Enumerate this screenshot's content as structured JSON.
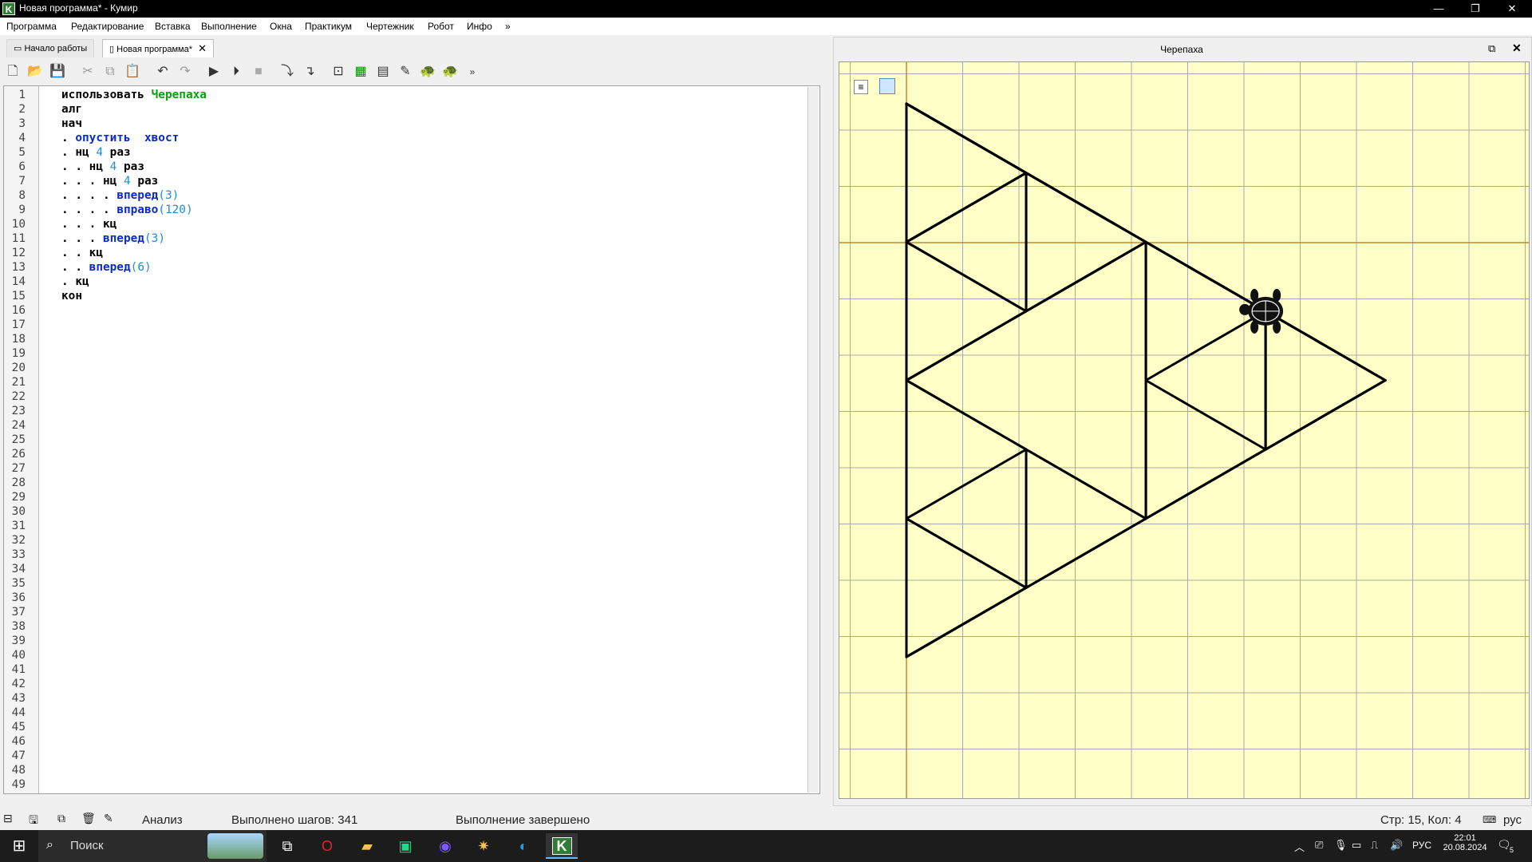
{
  "window": {
    "title": "Новая программа* - Кумир",
    "icon_letter": "K"
  },
  "menu": [
    "Программа",
    "Редактирование",
    "Вставка",
    "Выполнение",
    "Окна",
    "Практикум",
    "Чертежник",
    "Робот",
    "Инфо",
    "»"
  ],
  "tabs": [
    {
      "label": "Начало работы"
    },
    {
      "label": "Новая программа*"
    }
  ],
  "editor": {
    "line_count": 49,
    "lines": [
      [
        {
          "t": "использовать ",
          "c": "kw"
        },
        {
          "t": "Черепаха",
          "c": "green"
        }
      ],
      [
        {
          "t": "алг",
          "c": "kw"
        }
      ],
      [
        {
          "t": "нач",
          "c": "kw"
        }
      ],
      [
        {
          "t": ". ",
          "c": "dot"
        },
        {
          "t": "опустить  хвост",
          "c": "kwb"
        }
      ],
      [
        {
          "t": ". ",
          "c": "dot"
        },
        {
          "t": "нц ",
          "c": "kw"
        },
        {
          "t": "4",
          "c": "num"
        },
        {
          "t": " раз",
          "c": "kw"
        }
      ],
      [
        {
          "t": ". . ",
          "c": "dot"
        },
        {
          "t": "нц ",
          "c": "kw"
        },
        {
          "t": "4",
          "c": "num"
        },
        {
          "t": " раз",
          "c": "kw"
        }
      ],
      [
        {
          "t": ". . . ",
          "c": "dot"
        },
        {
          "t": "нц ",
          "c": "kw"
        },
        {
          "t": "4",
          "c": "num"
        },
        {
          "t": " раз",
          "c": "kw"
        }
      ],
      [
        {
          "t": ". . . . ",
          "c": "dot"
        },
        {
          "t": "вперед",
          "c": "kwb"
        },
        {
          "t": "(",
          "c": "paren"
        },
        {
          "t": "3",
          "c": "num"
        },
        {
          "t": ")",
          "c": "paren"
        }
      ],
      [
        {
          "t": ". . . . ",
          "c": "dot"
        },
        {
          "t": "вправо",
          "c": "kwb"
        },
        {
          "t": "(",
          "c": "paren"
        },
        {
          "t": "120",
          "c": "num"
        },
        {
          "t": ")",
          "c": "paren"
        }
      ],
      [
        {
          "t": ". . . ",
          "c": "dot"
        },
        {
          "t": "кц",
          "c": "kw"
        }
      ],
      [
        {
          "t": ". . . ",
          "c": "dot"
        },
        {
          "t": "вперед",
          "c": "kwb"
        },
        {
          "t": "(",
          "c": "paren"
        },
        {
          "t": "3",
          "c": "num"
        },
        {
          "t": ")",
          "c": "paren"
        }
      ],
      [
        {
          "t": ". . ",
          "c": "dot"
        },
        {
          "t": "кц",
          "c": "kw"
        }
      ],
      [
        {
          "t": ". . ",
          "c": "dot"
        },
        {
          "t": "вперед",
          "c": "kwb"
        },
        {
          "t": "(",
          "c": "paren"
        },
        {
          "t": "6",
          "c": "num"
        },
        {
          "t": ")",
          "c": "paren"
        }
      ],
      [
        {
          "t": ". ",
          "c": "dot"
        },
        {
          "t": "кц",
          "c": "kw"
        }
      ],
      [
        {
          "t": "кон",
          "c": "kw"
        }
      ]
    ]
  },
  "turtle_panel": {
    "title": "Черепаха"
  },
  "status": {
    "analysis": "Анализ",
    "steps": "Выполнено шагов: 341",
    "message": "Выполнение завершено",
    "cursor": "Стр: 15, Кол: 4",
    "lang": "рус"
  },
  "taskbar": {
    "search_placeholder": "Поиск",
    "lang": "РУС",
    "time": "22:01",
    "date": "20.08.2024",
    "notif_count": "5"
  },
  "colors": {
    "canvas_bg": "#ffffc8",
    "grid": "#a8a8a8",
    "axis": "#c08a2a",
    "keyword_blue": "#0a2bc8",
    "number_blue": "#1d8fd6",
    "green": "#08a10b"
  }
}
